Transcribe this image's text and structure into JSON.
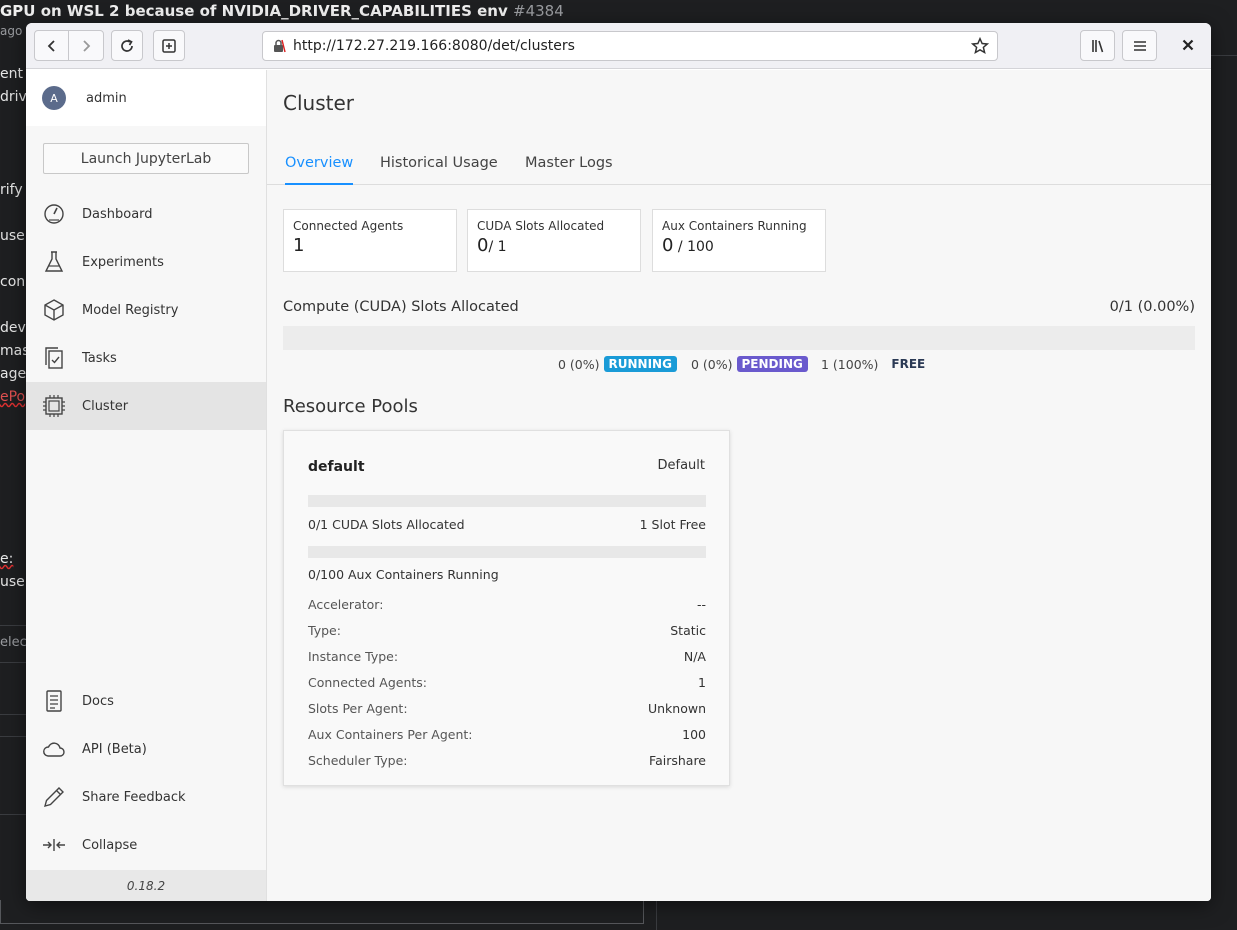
{
  "background": {
    "issue_title": "GPU on WSL 2 because of NVIDIA_DRIVER_CAPABILITIES env",
    "issue_number": "#4384",
    "fragments": [
      "ago",
      "ent",
      "driv",
      "rify",
      "user",
      "conn",
      "dev",
      "mast",
      "age",
      "ePo",
      "e:",
      "user",
      "elect"
    ]
  },
  "browser": {
    "url": "http://172.27.219.166:8080/det/clusters"
  },
  "sidebar": {
    "avatar_letter": "A",
    "username": "admin",
    "launch_label": "Launch JupyterLab",
    "items": [
      {
        "label": "Dashboard",
        "icon": "dashboard-icon"
      },
      {
        "label": "Experiments",
        "icon": "flask-icon"
      },
      {
        "label": "Model Registry",
        "icon": "cube-icon"
      },
      {
        "label": "Tasks",
        "icon": "tasks-icon"
      },
      {
        "label": "Cluster",
        "icon": "cluster-icon",
        "active": true
      }
    ],
    "bottom_items": [
      {
        "label": "Docs",
        "icon": "docs-icon"
      },
      {
        "label": "API (Beta)",
        "icon": "cloud-icon"
      },
      {
        "label": "Share Feedback",
        "icon": "pencil-icon"
      },
      {
        "label": "Collapse",
        "icon": "collapse-icon"
      }
    ],
    "version": "0.18.2"
  },
  "main": {
    "title": "Cluster",
    "tabs": [
      "Overview",
      "Historical Usage",
      "Master Logs"
    ],
    "stats": [
      {
        "label": "Connected Agents",
        "value": "1",
        "sub": ""
      },
      {
        "label": "CUDA Slots Allocated",
        "value": "0",
        "sub": "/ 1"
      },
      {
        "label": "Aux Containers Running",
        "value": "0",
        "sub": " / 100"
      }
    ],
    "compute_title": "Compute (CUDA) Slots Allocated",
    "compute_pct": "0/1 (0.00%)",
    "legend": {
      "running_value": "0 (0%)",
      "running_label": "RUNNING",
      "pending_value": "0 (0%)",
      "pending_label": "PENDING",
      "free_value": "1 (100%)",
      "free_label": "FREE"
    },
    "pools_title": "Resource Pools",
    "pool": {
      "name": "default",
      "tag": "Default",
      "cuda_line": "0/1 CUDA Slots Allocated",
      "slots_free": "1 Slot Free",
      "aux_line": "0/100 Aux Containers Running",
      "details": [
        {
          "k": "Accelerator:",
          "v": "--"
        },
        {
          "k": "Type:",
          "v": "Static"
        },
        {
          "k": "Instance Type:",
          "v": "N/A"
        },
        {
          "k": "Connected Agents:",
          "v": "1"
        },
        {
          "k": "Slots Per Agent:",
          "v": "Unknown"
        },
        {
          "k": "Aux Containers Per Agent:",
          "v": "100"
        },
        {
          "k": "Scheduler Type:",
          "v": "Fairshare"
        }
      ]
    }
  },
  "colors": {
    "accent": "#1890ff",
    "running": "#1a9bd7",
    "pending": "#6a5acd"
  }
}
